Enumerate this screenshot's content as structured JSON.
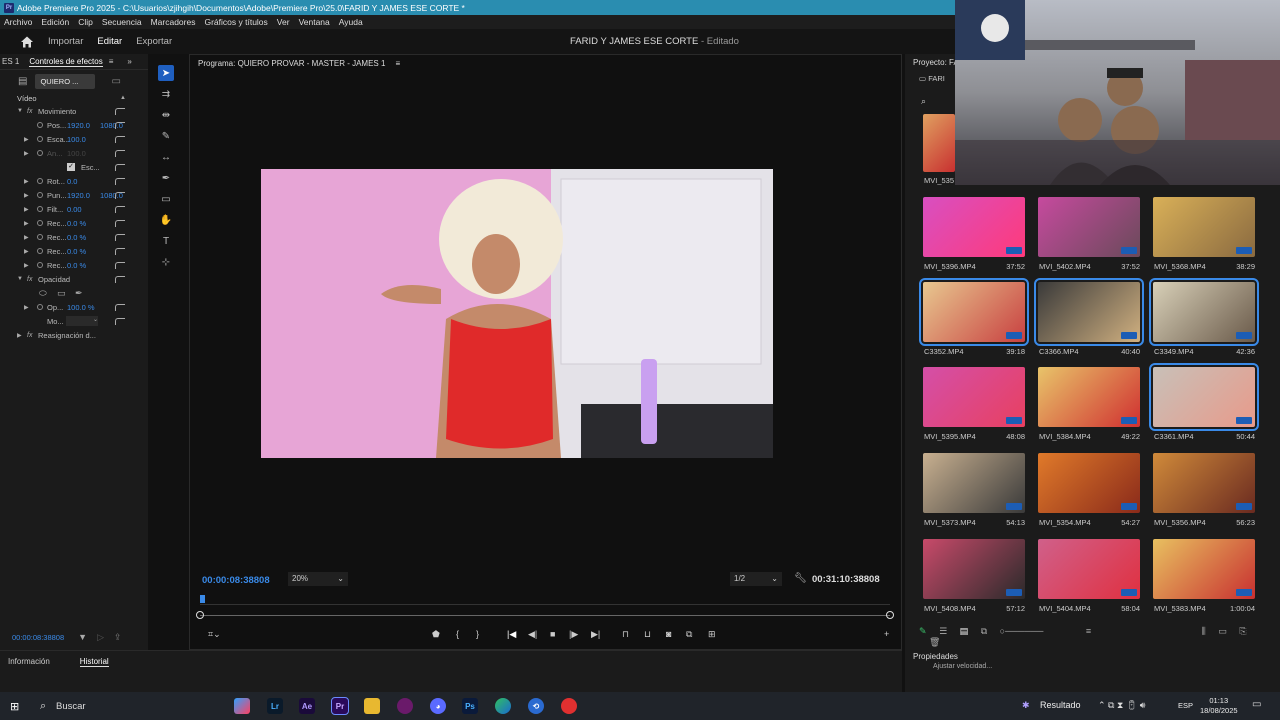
{
  "window": {
    "title": "Adobe Premiere Pro 2025 - C:\\Usuarios\\zjihgih\\Documentos\\Adobe\\Premiere Pro\\25.0\\FARID Y JAMES ESE CORTE *"
  },
  "menu": [
    "Archivo",
    "Edición",
    "Clip",
    "Secuencia",
    "Marcadores",
    "Gráficos y títulos",
    "Ver",
    "Ventana",
    "Ayuda"
  ],
  "header": {
    "nav": [
      "Importar",
      "Editar",
      "Exportar"
    ],
    "doc_title": "FARID Y JAMES ESE CORTE",
    "doc_status": "- Editado"
  },
  "effects_panel": {
    "tab_prev": "ES 1",
    "tab_active": "Controles de efectos",
    "clip_chip": "QUIERO ...",
    "section_video": "Vídeo",
    "rows": [
      {
        "label": "Movimiento",
        "value": "",
        "value2": ""
      },
      {
        "label": "Pos...",
        "value": "1920.0",
        "value2": "1080.0"
      },
      {
        "label": "Esca...",
        "value": "100.0",
        "value2": ""
      },
      {
        "label": "An...",
        "value": "100.0",
        "value2": ""
      },
      {
        "label": "Esc...",
        "value": "",
        "value2": ""
      },
      {
        "label": "Rot...",
        "value": "0.0",
        "value2": ""
      },
      {
        "label": "Pun...",
        "value": "1920.0",
        "value2": "1080.0"
      },
      {
        "label": "Filt...",
        "value": "0.00",
        "value2": ""
      },
      {
        "label": "Rec...",
        "value": "0.0 %",
        "value2": ""
      },
      {
        "label": "Rec...",
        "value": "0.0 %",
        "value2": ""
      },
      {
        "label": "Rec...",
        "value": "0.0 %",
        "value2": ""
      },
      {
        "label": "Rec...",
        "value": "0.0 %",
        "value2": ""
      },
      {
        "label": "Opacidad",
        "value": "",
        "value2": ""
      },
      {
        "label": "",
        "value": "",
        "value2": ""
      },
      {
        "label": "Op...",
        "value": "100.0 %",
        "value2": ""
      },
      {
        "label": "Mo...",
        "value": "",
        "value2": ""
      },
      {
        "label": "Reasignación d...",
        "value": "",
        "value2": ""
      }
    ],
    "timecode": "00:00:08:38808"
  },
  "monitor": {
    "title": "Programa: QUIERO PROVAR - MASTER - JAMES 1",
    "timecode_current": "00:00:08:38808",
    "zoom": "20%",
    "resolution": "1/2",
    "timecode_total": "00:31:10:38808"
  },
  "project": {
    "title": "Proyecto: FA",
    "bin": "FARI",
    "top_clip": "MVI_535",
    "clips": [
      {
        "name": "MVI_5396.MP4",
        "duration": "37:52",
        "selected": false,
        "color1": "#d84fc1",
        "color2": "#ff3a7a"
      },
      {
        "name": "MVI_5402.MP4",
        "duration": "37:52",
        "selected": false,
        "color1": "#c64a9e",
        "color2": "#6a4a5a"
      },
      {
        "name": "MVI_5368.MP4",
        "duration": "38:29",
        "selected": false,
        "color1": "#d9b058",
        "color2": "#8a6a40"
      },
      {
        "name": "C3352.MP4",
        "duration": "39:18",
        "selected": true,
        "color1": "#e8c890",
        "color2": "#c84040"
      },
      {
        "name": "C3366.MP4",
        "duration": "40:40",
        "selected": true,
        "color1": "#3a3a3a",
        "color2": "#d0b080"
      },
      {
        "name": "C3349.MP4",
        "duration": "42:36",
        "selected": true,
        "color1": "#d8d0b8",
        "color2": "#6a5a4a"
      },
      {
        "name": "MVI_5395.MP4",
        "duration": "48:08",
        "selected": false,
        "color1": "#d44fa8",
        "color2": "#e84060"
      },
      {
        "name": "MVI_5384.MP4",
        "duration": "49:22",
        "selected": false,
        "color1": "#e8c46a",
        "color2": "#d03030"
      },
      {
        "name": "C3361.MP4",
        "duration": "50:44",
        "selected": true,
        "color1": "#c8c0b8",
        "color2": "#e89a8a"
      },
      {
        "name": "MVI_5373.MP4",
        "duration": "54:13",
        "selected": false,
        "color1": "#c8b090",
        "color2": "#3a3a3a"
      },
      {
        "name": "MVI_5354.MP4",
        "duration": "54:27",
        "selected": false,
        "color1": "#e07a2a",
        "color2": "#8a2a1a"
      },
      {
        "name": "MVI_5356.MP4",
        "duration": "56:23",
        "selected": false,
        "color1": "#d08a3a",
        "color2": "#6a2a20"
      },
      {
        "name": "MVI_5408.MP4",
        "duration": "57:12",
        "selected": false,
        "color1": "#c84a6a",
        "color2": "#2a2a2a"
      },
      {
        "name": "MVI_5404.MP4",
        "duration": "58:04",
        "selected": false,
        "color1": "#d0608a",
        "color2": "#e03040"
      },
      {
        "name": "MVI_5383.MP4",
        "duration": "1:00:04",
        "selected": false,
        "color1": "#e8c060",
        "color2": "#c83030"
      }
    ]
  },
  "bottom": {
    "tabs": [
      "Información",
      "Historial"
    ],
    "props_title": "Propiedades",
    "props_item": "Ajustar velocidad..."
  },
  "taskbar": {
    "search": "Buscar",
    "tray_label": "Resultado",
    "lang": "ESP",
    "time": "01:13",
    "date": "18/08/2025"
  }
}
